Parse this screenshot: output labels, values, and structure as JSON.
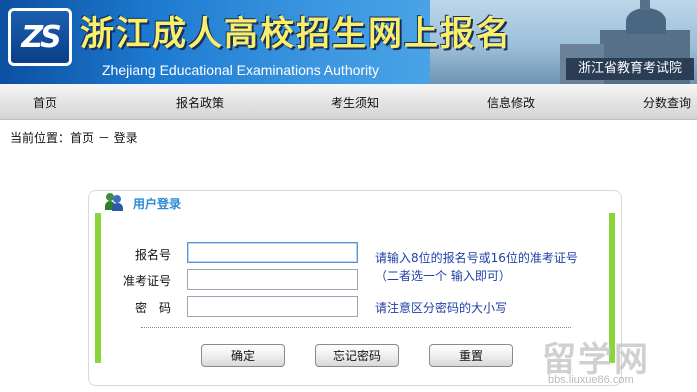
{
  "banner": {
    "logo_text": "ZS",
    "title": "浙江成人高校招生网上报名",
    "subtitle": "Zhejiang Educational Examinations Authority",
    "authority": "浙江省教育考试院"
  },
  "nav": {
    "items": [
      {
        "label": "首页"
      },
      {
        "label": "报名政策"
      },
      {
        "label": "考生须知"
      },
      {
        "label": "信息修改"
      },
      {
        "label": "分数查询"
      }
    ]
  },
  "breadcrumb": "当前位置：首页 － 登录",
  "login": {
    "title": "用户登录",
    "icon": "users-icon",
    "fields": [
      {
        "label": "报名号",
        "value": "",
        "hint": "请输入8位的报名号或16位的准考证号"
      },
      {
        "label": "准考证号",
        "value": "",
        "hint": "（二者选一个 输入即可）"
      },
      {
        "label": "密　码",
        "value": "",
        "hint": "请注意区分密码的大小写"
      }
    ],
    "buttons": {
      "confirm": "确定",
      "forgot": "忘记密码",
      "reset": "重置"
    }
  },
  "watermark": {
    "main": "留学网",
    "sub": "bbs.liuxue86.com"
  },
  "colors": {
    "accent_green": "#8ad43c",
    "hint_blue": "#1f3fa6",
    "title_blue": "#2c8bd3",
    "banner_title": "#f8ef6a"
  }
}
